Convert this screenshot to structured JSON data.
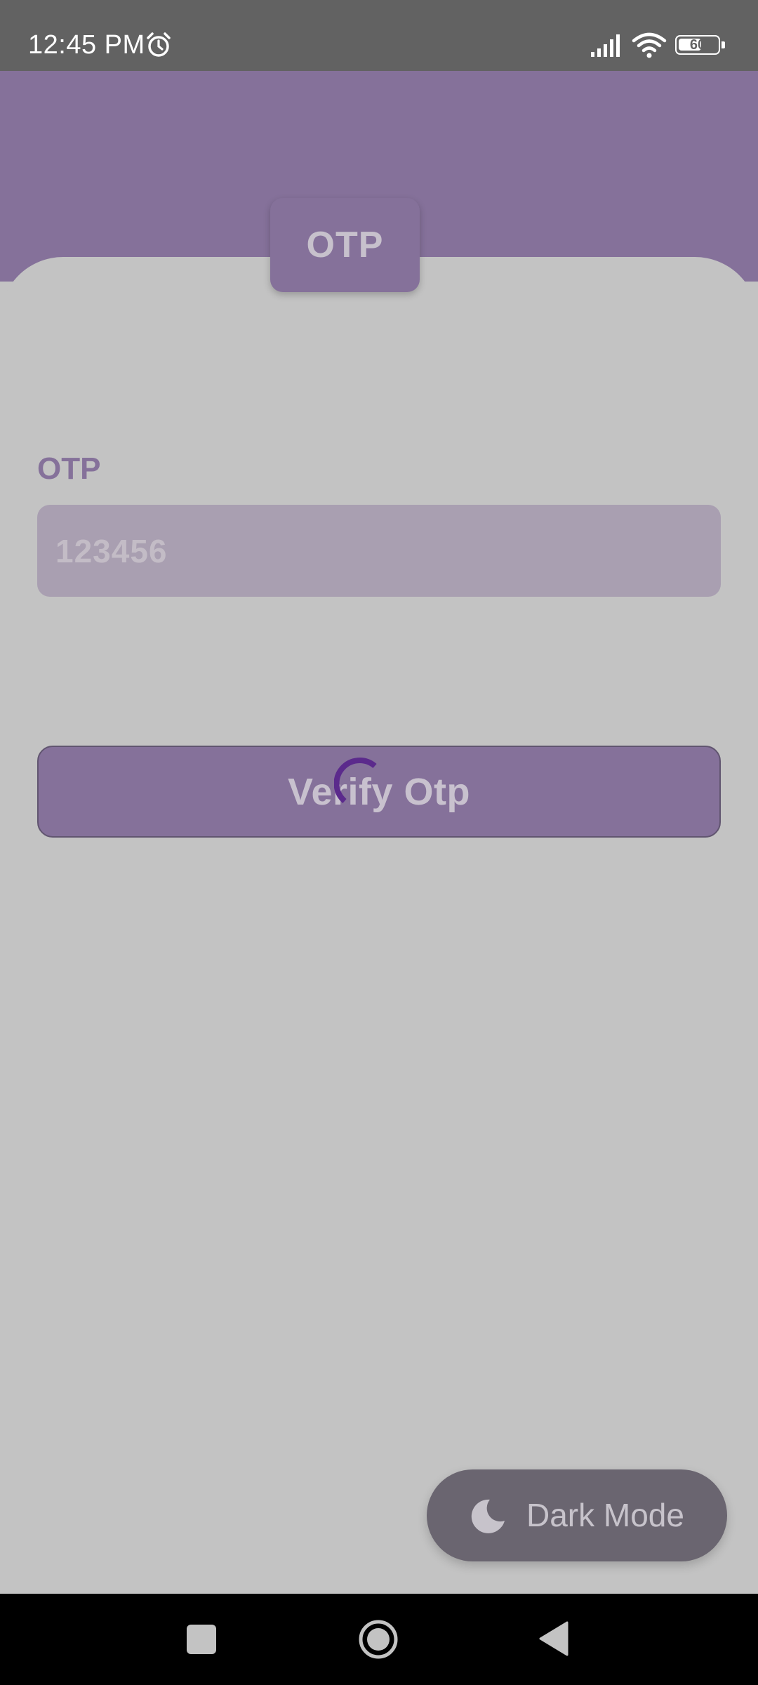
{
  "status_bar": {
    "time": "12:45 PM",
    "battery_level": "60",
    "battery_fraction": 0.6,
    "icons": [
      "alarm-icon",
      "signal-icon",
      "wifi-icon",
      "battery-icon"
    ]
  },
  "header": {
    "badge_title": "OTP"
  },
  "form": {
    "otp_label": "OTP",
    "otp_value": "123456",
    "verify_button_label": "Verify Otp",
    "loading": true
  },
  "dark_mode": {
    "label": "Dark Mode",
    "icon": "moon-icon"
  },
  "nav_bar": {
    "icons": [
      "recents-icon",
      "home-icon",
      "back-icon"
    ]
  },
  "colors": {
    "accent": "#85719a",
    "background": "#c3c3c3",
    "status_bar": "#626262",
    "spinner": "#5b2a8c",
    "dark_mode_button": "#6a6570"
  }
}
